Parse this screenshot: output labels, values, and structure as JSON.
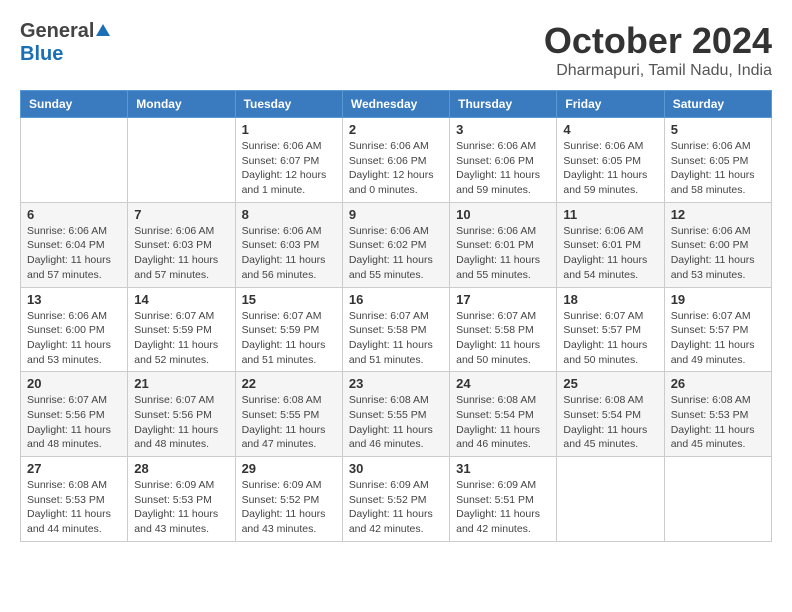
{
  "header": {
    "logo_general": "General",
    "logo_blue": "Blue",
    "month_title": "October 2024",
    "subtitle": "Dharmapuri, Tamil Nadu, India"
  },
  "weekdays": [
    "Sunday",
    "Monday",
    "Tuesday",
    "Wednesday",
    "Thursday",
    "Friday",
    "Saturday"
  ],
  "weeks": [
    [
      {
        "day": "",
        "info": ""
      },
      {
        "day": "",
        "info": ""
      },
      {
        "day": "1",
        "sunrise": "6:06 AM",
        "sunset": "6:07 PM",
        "daylight": "12 hours and 1 minute."
      },
      {
        "day": "2",
        "sunrise": "6:06 AM",
        "sunset": "6:06 PM",
        "daylight": "12 hours and 0 minutes."
      },
      {
        "day": "3",
        "sunrise": "6:06 AM",
        "sunset": "6:06 PM",
        "daylight": "11 hours and 59 minutes."
      },
      {
        "day": "4",
        "sunrise": "6:06 AM",
        "sunset": "6:05 PM",
        "daylight": "11 hours and 59 minutes."
      },
      {
        "day": "5",
        "sunrise": "6:06 AM",
        "sunset": "6:05 PM",
        "daylight": "11 hours and 58 minutes."
      }
    ],
    [
      {
        "day": "6",
        "sunrise": "6:06 AM",
        "sunset": "6:04 PM",
        "daylight": "11 hours and 57 minutes."
      },
      {
        "day": "7",
        "sunrise": "6:06 AM",
        "sunset": "6:03 PM",
        "daylight": "11 hours and 57 minutes."
      },
      {
        "day": "8",
        "sunrise": "6:06 AM",
        "sunset": "6:03 PM",
        "daylight": "11 hours and 56 minutes."
      },
      {
        "day": "9",
        "sunrise": "6:06 AM",
        "sunset": "6:02 PM",
        "daylight": "11 hours and 55 minutes."
      },
      {
        "day": "10",
        "sunrise": "6:06 AM",
        "sunset": "6:01 PM",
        "daylight": "11 hours and 55 minutes."
      },
      {
        "day": "11",
        "sunrise": "6:06 AM",
        "sunset": "6:01 PM",
        "daylight": "11 hours and 54 minutes."
      },
      {
        "day": "12",
        "sunrise": "6:06 AM",
        "sunset": "6:00 PM",
        "daylight": "11 hours and 53 minutes."
      }
    ],
    [
      {
        "day": "13",
        "sunrise": "6:06 AM",
        "sunset": "6:00 PM",
        "daylight": "11 hours and 53 minutes."
      },
      {
        "day": "14",
        "sunrise": "6:07 AM",
        "sunset": "5:59 PM",
        "daylight": "11 hours and 52 minutes."
      },
      {
        "day": "15",
        "sunrise": "6:07 AM",
        "sunset": "5:59 PM",
        "daylight": "11 hours and 51 minutes."
      },
      {
        "day": "16",
        "sunrise": "6:07 AM",
        "sunset": "5:58 PM",
        "daylight": "11 hours and 51 minutes."
      },
      {
        "day": "17",
        "sunrise": "6:07 AM",
        "sunset": "5:58 PM",
        "daylight": "11 hours and 50 minutes."
      },
      {
        "day": "18",
        "sunrise": "6:07 AM",
        "sunset": "5:57 PM",
        "daylight": "11 hours and 50 minutes."
      },
      {
        "day": "19",
        "sunrise": "6:07 AM",
        "sunset": "5:57 PM",
        "daylight": "11 hours and 49 minutes."
      }
    ],
    [
      {
        "day": "20",
        "sunrise": "6:07 AM",
        "sunset": "5:56 PM",
        "daylight": "11 hours and 48 minutes."
      },
      {
        "day": "21",
        "sunrise": "6:07 AM",
        "sunset": "5:56 PM",
        "daylight": "11 hours and 48 minutes."
      },
      {
        "day": "22",
        "sunrise": "6:08 AM",
        "sunset": "5:55 PM",
        "daylight": "11 hours and 47 minutes."
      },
      {
        "day": "23",
        "sunrise": "6:08 AM",
        "sunset": "5:55 PM",
        "daylight": "11 hours and 46 minutes."
      },
      {
        "day": "24",
        "sunrise": "6:08 AM",
        "sunset": "5:54 PM",
        "daylight": "11 hours and 46 minutes."
      },
      {
        "day": "25",
        "sunrise": "6:08 AM",
        "sunset": "5:54 PM",
        "daylight": "11 hours and 45 minutes."
      },
      {
        "day": "26",
        "sunrise": "6:08 AM",
        "sunset": "5:53 PM",
        "daylight": "11 hours and 45 minutes."
      }
    ],
    [
      {
        "day": "27",
        "sunrise": "6:08 AM",
        "sunset": "5:53 PM",
        "daylight": "11 hours and 44 minutes."
      },
      {
        "day": "28",
        "sunrise": "6:09 AM",
        "sunset": "5:53 PM",
        "daylight": "11 hours and 43 minutes."
      },
      {
        "day": "29",
        "sunrise": "6:09 AM",
        "sunset": "5:52 PM",
        "daylight": "11 hours and 43 minutes."
      },
      {
        "day": "30",
        "sunrise": "6:09 AM",
        "sunset": "5:52 PM",
        "daylight": "11 hours and 42 minutes."
      },
      {
        "day": "31",
        "sunrise": "6:09 AM",
        "sunset": "5:51 PM",
        "daylight": "11 hours and 42 minutes."
      },
      {
        "day": "",
        "info": ""
      },
      {
        "day": "",
        "info": ""
      }
    ]
  ]
}
